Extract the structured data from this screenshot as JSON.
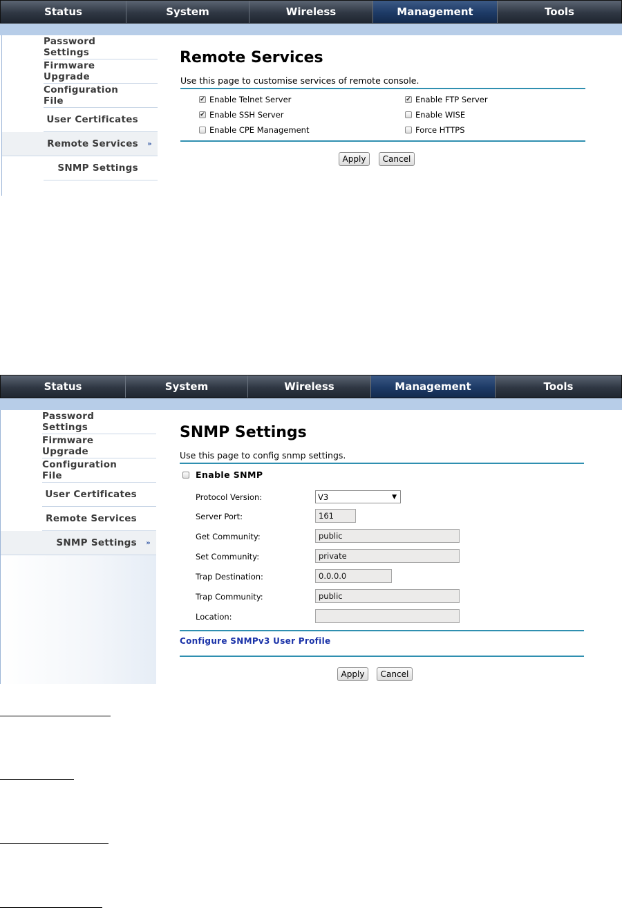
{
  "panel1": {
    "nav": [
      "Status",
      "System",
      "Wireless",
      "Management",
      "Tools"
    ],
    "nav_active": "Management",
    "sidebar": [
      "Password Settings",
      "Firmware Upgrade",
      "Configuration File",
      "User Certificates",
      "Remote Services",
      "SNMP Settings"
    ],
    "sidebar_active": "Remote Services",
    "title": "Remote Services",
    "description": "Use this page to customise services of remote console.",
    "checkboxes": [
      {
        "label": "Enable Telnet Server",
        "checked": true
      },
      {
        "label": "Enable FTP Server",
        "checked": true
      },
      {
        "label": "Enable SSH Server",
        "checked": true
      },
      {
        "label": "Enable WISE",
        "checked": false
      },
      {
        "label": "Enable CPE Management",
        "checked": false
      },
      {
        "label": "Force HTTPS",
        "checked": false
      }
    ],
    "apply_label": "Apply",
    "cancel_label": "Cancel"
  },
  "panel2": {
    "nav": [
      "Status",
      "System",
      "Wireless",
      "Management",
      "Tools"
    ],
    "nav_active": "Management",
    "sidebar": [
      "Password Settings",
      "Firmware Upgrade",
      "Configuration File",
      "User Certificates",
      "Remote Services",
      "SNMP Settings"
    ],
    "sidebar_active": "SNMP Settings",
    "title": "SNMP Settings",
    "description": "Use this page to config snmp settings.",
    "enable_snmp_label": "Enable SNMP",
    "enable_snmp_checked": false,
    "fields": {
      "protocol_version_label": "Protocol Version:",
      "protocol_version_value": "V3",
      "server_port_label": "Server Port:",
      "server_port_value": "161",
      "get_community_label": "Get Community:",
      "get_community_value": "public",
      "set_community_label": "Set Community:",
      "set_community_value": "private",
      "trap_destination_label": "Trap Destination:",
      "trap_destination_value": "0.0.0.0",
      "trap_community_label": "Trap Community:",
      "trap_community_value": "public",
      "location_label": "Location:",
      "location_value": ""
    },
    "snmpv3_link": "Configure SNMPv3 User Profile",
    "apply_label": "Apply",
    "cancel_label": "Cancel"
  },
  "colors": {
    "nav_bg": "#2f3743",
    "nav_active": "#1d3a66",
    "band": "#b7cde8",
    "rule": "#2f8fb0",
    "link": "#1a32a8"
  }
}
